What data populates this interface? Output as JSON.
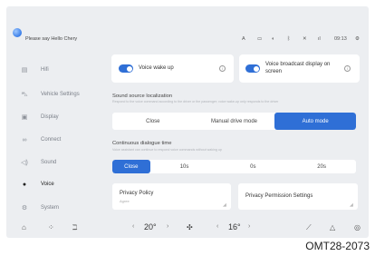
{
  "header": {
    "prompt": "Please say Hello Chery",
    "status_icons": [
      "A-icon",
      "display-icon",
      "brightness-icon",
      "bluetooth-icon",
      "mute-icon",
      "signal-icon"
    ],
    "time": "09:13"
  },
  "sidebar": {
    "items": [
      {
        "label": "Hifi",
        "icon": "music-icon"
      },
      {
        "label": "Vehicle Settings",
        "icon": "car-icon"
      },
      {
        "label": "Display",
        "icon": "display-icon"
      },
      {
        "label": "Connect",
        "icon": "link-icon"
      },
      {
        "label": "Sound",
        "icon": "speaker-icon"
      },
      {
        "label": "Voice",
        "icon": "microphone-icon",
        "active": true
      },
      {
        "label": "System",
        "icon": "gear-icon"
      }
    ]
  },
  "main": {
    "voice_wakeup": {
      "label": "Voice wake up",
      "on": true
    },
    "voice_broadcast": {
      "label": "Voice broadcast display on screen",
      "on": true
    },
    "sound_source": {
      "title": "Sound source localization",
      "description": "Respond to the voice command according to the driver or the passenger; voice wake-up only responds to the driver",
      "options": [
        "Close",
        "Manual drive mode",
        "Auto mode"
      ],
      "selected": "Auto mode"
    },
    "continuous": {
      "title": "Continuous dialogue time",
      "description": "Voice assistant can continue to respond voice commands without waking up",
      "options": [
        "Close",
        "10s",
        "0s",
        "20s"
      ],
      "selected": "Close"
    },
    "privacy_policy": {
      "title": "Privacy Policy",
      "subtitle": "Agree"
    },
    "privacy_permission": {
      "title": "Privacy Permission Settings"
    }
  },
  "dock": {
    "left_temp": "20°",
    "right_temp": "16°",
    "icons": [
      "home-icon",
      "apps-icon",
      "seat-icon",
      "fan-icon",
      "wiper-icon",
      "triangle-icon",
      "assistant-icon"
    ]
  },
  "caption": "OMT28-2073",
  "colors": {
    "accent": "#2f6fd6",
    "background": "#eceef1",
    "card": "#ffffff"
  }
}
